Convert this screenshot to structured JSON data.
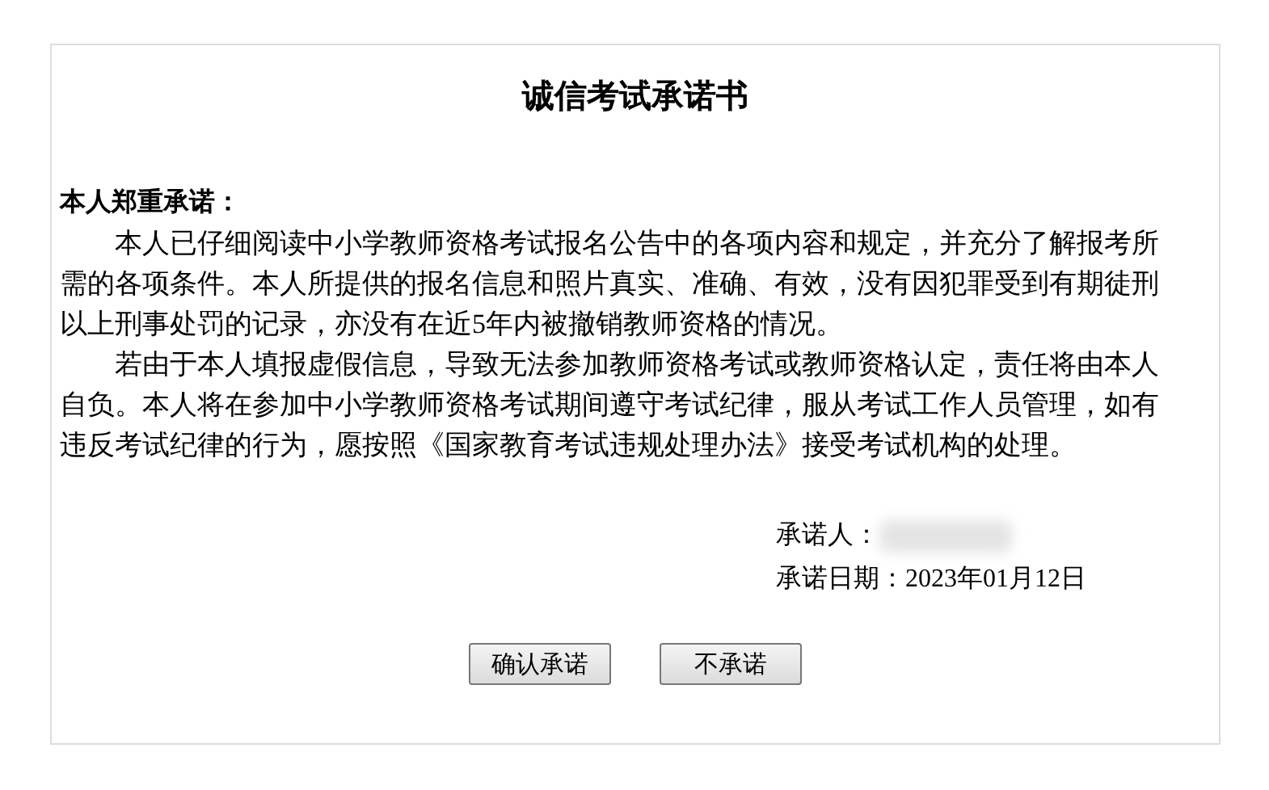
{
  "title": "诚信考试承诺书",
  "heading": "本人郑重承诺：",
  "paragraphs": [
    "本人已仔细阅读中小学教师资格考试报名公告中的各项内容和规定，并充分了解报考所需的各项条件。本人所提供的报名信息和照片真实、准确、有效，没有因犯罪受到有期徒刑以上刑事处罚的记录，亦没有在近5年内被撤销教师资格的情况。",
    "若由于本人填报虚假信息，导致无法参加教师资格考试或教师资格认定，责任将由本人自负。本人将在参加中小学教师资格考试期间遵守考试纪律，服从考试工作人员管理，如有违反考试纪律的行为，愿按照《国家教育考试违规处理办法》接受考试机构的处理。"
  ],
  "signer_label": "承诺人：",
  "date_line": "承诺日期：2023年01月12日",
  "buttons": [
    "确认承诺",
    "不承诺"
  ]
}
